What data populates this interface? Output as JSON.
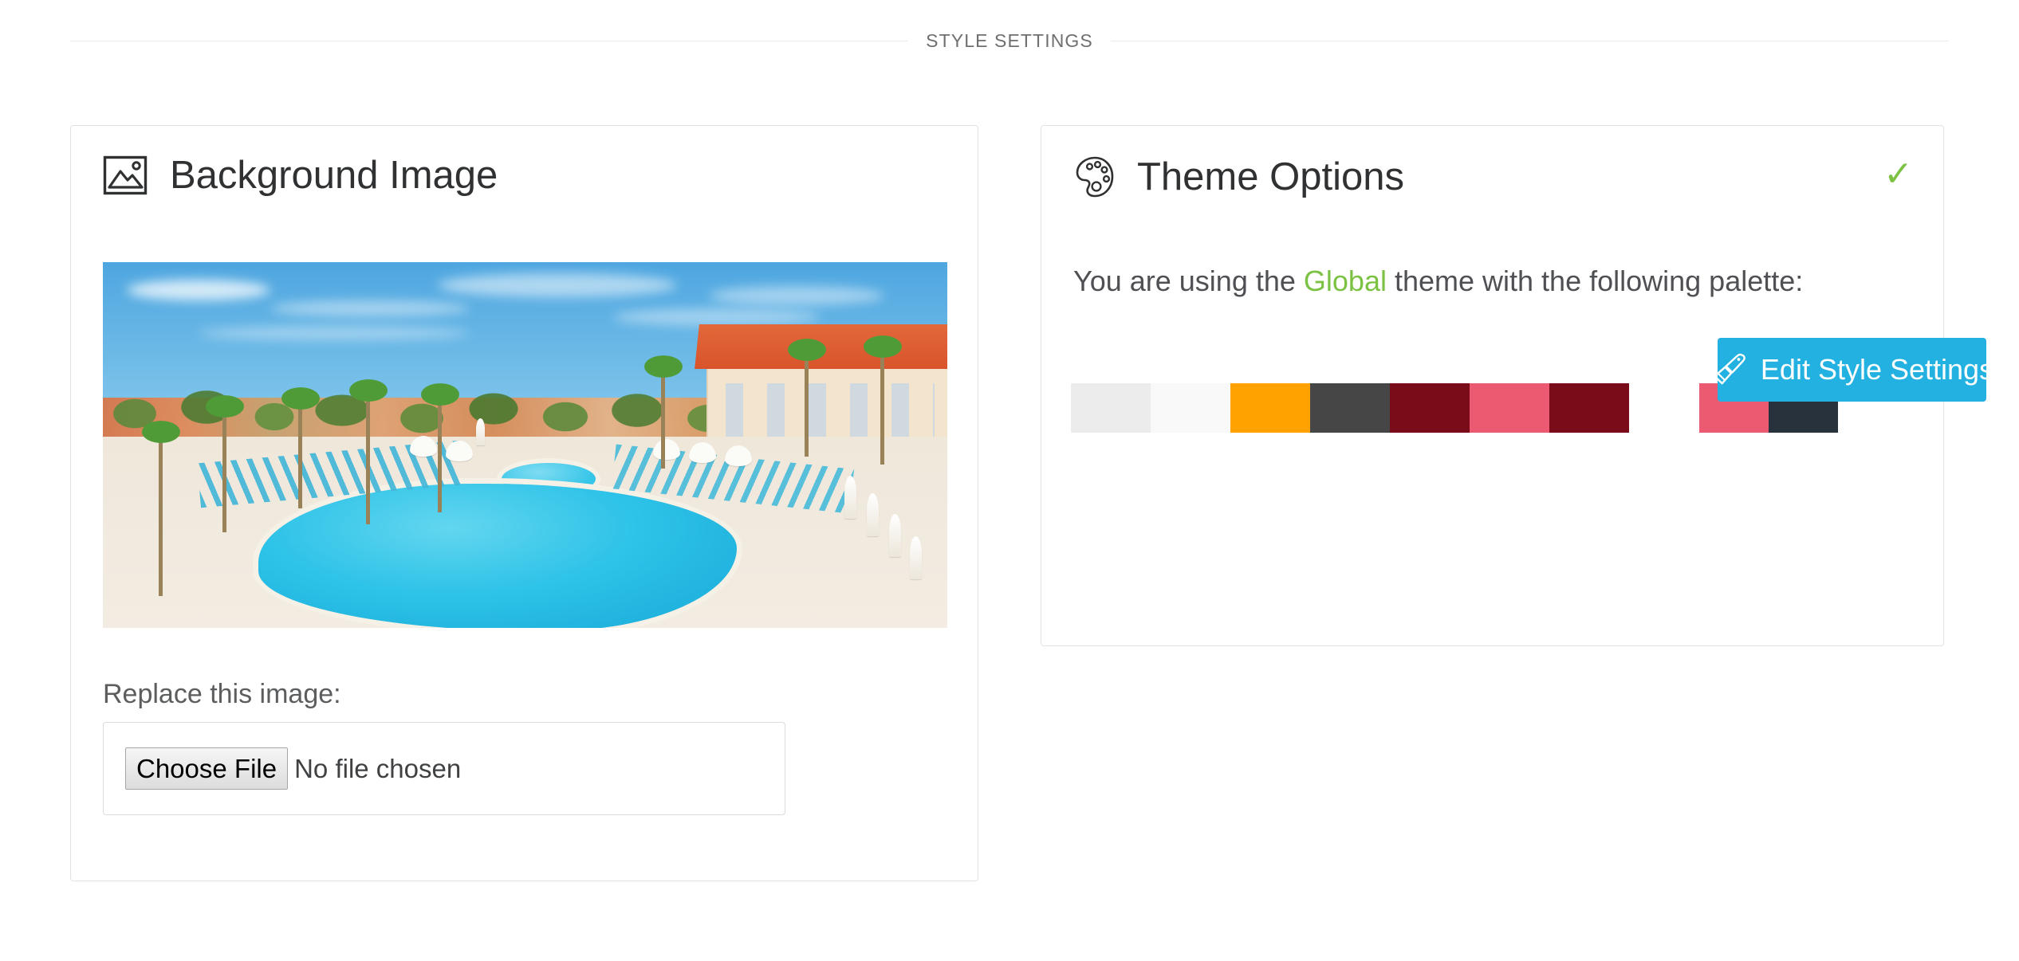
{
  "section": {
    "title": "STYLE SETTINGS"
  },
  "background_image_card": {
    "icon": "image-icon",
    "title": "Background Image",
    "preview": {
      "alt": "Resort swimming pool with palm trees, lounge chairs, white umbrellas and a terracotta-roofed hotel building"
    },
    "replace_label": "Replace this image:",
    "file_input": {
      "button_label": "Choose File",
      "status_text": "No file chosen"
    }
  },
  "theme_options_card": {
    "icon": "palette-icon",
    "title": "Theme Options",
    "status_icon": "check-icon",
    "status_color": "#7bc143",
    "description": {
      "prefix": "You are using the ",
      "theme_name": "Global",
      "suffix": " theme with the following palette:"
    },
    "palette": {
      "groups": [
        {
          "name": "primary-palette",
          "colors": [
            "#ececec",
            "#f9f9f9",
            "#ffa200",
            "#464646",
            "#7a0c19",
            "#ec5a71",
            "#7a0c19"
          ]
        },
        {
          "name": "accent-palette",
          "colors": [
            "#ec5a71",
            "#28323c"
          ]
        }
      ]
    },
    "edit_button": {
      "icon": "paintbrush-icon",
      "label": "Edit Style Settings",
      "color": "#22b1e0"
    }
  }
}
